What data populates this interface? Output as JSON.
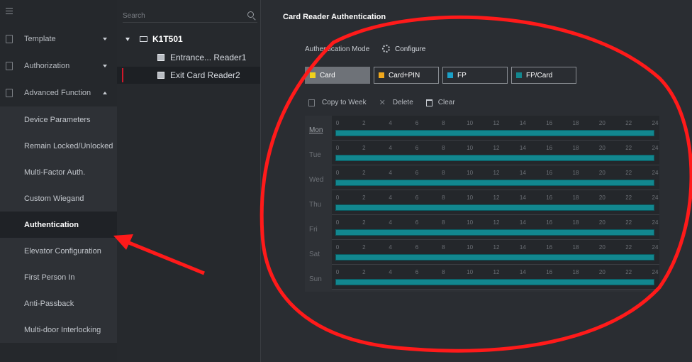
{
  "nav": {
    "groups": [
      {
        "label": "Template",
        "caret": "down"
      },
      {
        "label": "Authorization",
        "caret": "down"
      },
      {
        "label": "Advanced Function",
        "caret": "up"
      }
    ],
    "items": [
      {
        "label": "Device Parameters"
      },
      {
        "label": "Remain Locked/Unlocked"
      },
      {
        "label": "Multi-Factor Auth."
      },
      {
        "label": "Custom Wiegand"
      },
      {
        "label": "Authentication"
      },
      {
        "label": "Elevator Configuration"
      },
      {
        "label": "First Person In"
      },
      {
        "label": "Anti-Passback"
      },
      {
        "label": "Multi-door Interlocking"
      }
    ],
    "active_item": "Authentication"
  },
  "tree": {
    "search_placeholder": "Search",
    "root": "K1T501",
    "readers": [
      "Entrance... Reader1",
      "Exit Card Reader2"
    ],
    "selected_reader": "Exit Card Reader2"
  },
  "main": {
    "title": "Card Reader Authentication",
    "auth_mode_label": "Authentication Mode",
    "configure_label": "Configure",
    "modes": [
      {
        "label": "Card",
        "color": "#f2d21b"
      },
      {
        "label": "Card+PIN",
        "color": "#f0a81c"
      },
      {
        "label": "FP",
        "color": "#1aa0c8"
      },
      {
        "label": "FP/Card",
        "color": "#12878f"
      }
    ],
    "active_mode": "Card",
    "actions": {
      "copy": "Copy to Week",
      "delete": "Delete",
      "clear": "Clear"
    },
    "days": [
      "Mon",
      "Tue",
      "Wed",
      "Thu",
      "Fri",
      "Sat",
      "Sun"
    ],
    "selected_day": "Mon",
    "hour_ticks": [
      "0",
      "2",
      "4",
      "6",
      "8",
      "10",
      "12",
      "14",
      "16",
      "18",
      "20",
      "22",
      "24"
    ],
    "schedule_color": "#12878f"
  }
}
